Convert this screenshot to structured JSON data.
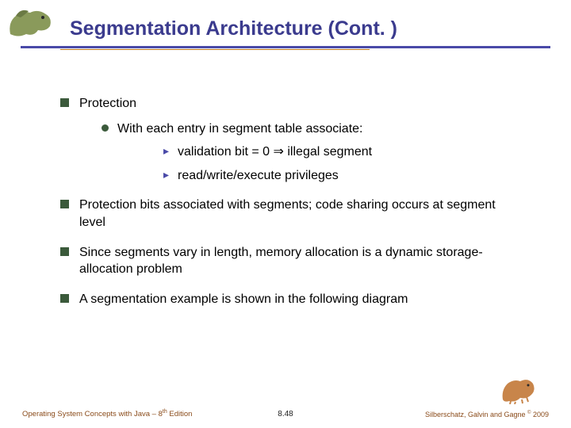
{
  "title": "Segmentation Architecture (Cont. )",
  "bullets": {
    "b1": "Protection",
    "b1a": "With each entry in segment table associate:",
    "b1a1": "validation bit = 0 ⇒ illegal segment",
    "b1a2": "read/write/execute privileges",
    "b2": "Protection bits associated with segments; code sharing occurs at segment level",
    "b3": "Since segments vary in length, memory allocation is a dynamic storage-allocation problem",
    "b4": "A segmentation example is shown in the following diagram"
  },
  "footer": {
    "left_prefix": "Operating System Concepts with Java – 8",
    "left_suffix": " Edition",
    "left_sup": "th",
    "center": "8.48",
    "right_prefix": "Silberschatz, Galvin and Gagne ",
    "right_suffix": " 2009",
    "right_sym": "©"
  },
  "icons": {
    "top_dino": "dinosaur-icon",
    "bottom_dino": "dinosaur-icon"
  }
}
